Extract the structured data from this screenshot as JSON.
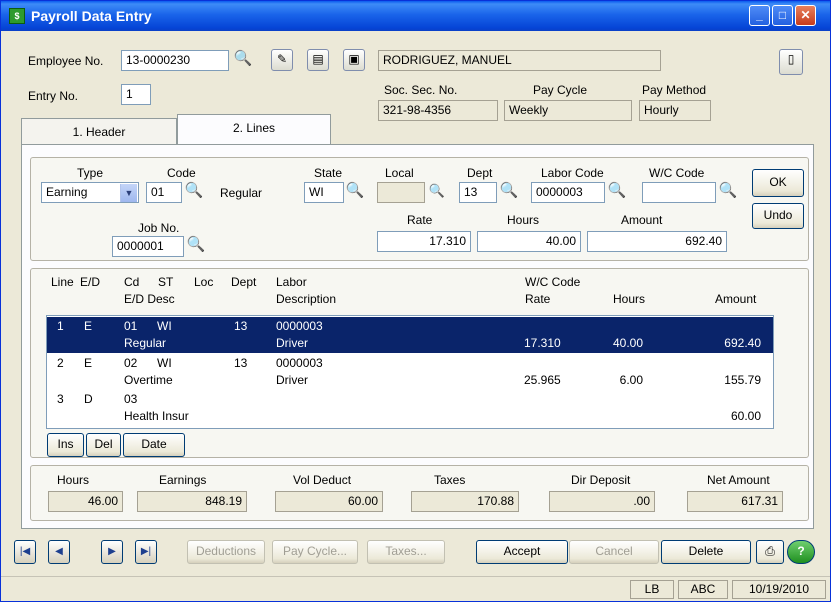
{
  "window": {
    "title": "Payroll Data Entry"
  },
  "header": {
    "employee_no_label": "Employee No.",
    "employee_no": "13-0000230",
    "employee_name": "RODRIGUEZ, MANUEL",
    "entry_no_label": "Entry No.",
    "entry_no": "1",
    "ssn_label": "Soc. Sec. No.",
    "ssn": "321-98-4356",
    "pay_cycle_label": "Pay Cycle",
    "pay_cycle": "Weekly",
    "pay_method_label": "Pay Method",
    "pay_method": "Hourly"
  },
  "tabs": [
    {
      "label": "1. Header",
      "active": false
    },
    {
      "label": "2. Lines",
      "active": true
    }
  ],
  "line_entry": {
    "type_label": "Type",
    "type_value": "Earning",
    "code_label": "Code",
    "code_value": "01",
    "code_desc": "Regular",
    "state_label": "State",
    "state_value": "WI",
    "local_label": "Local",
    "local_value": "",
    "dept_label": "Dept",
    "dept_value": "13",
    "labor_code_label": "Labor Code",
    "labor_code_value": "0000003",
    "wc_code_label": "W/C Code",
    "wc_code_value": "",
    "job_no_label": "Job No.",
    "job_no_value": "0000001",
    "rate_label": "Rate",
    "rate_value": "17.310",
    "hours_label": "Hours",
    "hours_value": "40.00",
    "amount_label": "Amount",
    "amount_value": "692.40",
    "ok_label": "OK",
    "undo_label": "Undo"
  },
  "grid": {
    "headers_row1": [
      "Line",
      "E/D",
      "Cd",
      "ST",
      "Loc",
      "Dept",
      "Labor",
      "W/C Code"
    ],
    "headers_row2": [
      "E/D Desc",
      "Description",
      "Rate",
      "Hours",
      "Amount"
    ],
    "rows": [
      {
        "line": "1",
        "ed": "E",
        "cd": "01",
        "st": "WI",
        "dept": "13",
        "labor": "0000003",
        "desc": "Regular",
        "labor_desc": "Driver",
        "rate": "17.310",
        "hours": "40.00",
        "amount": "692.40",
        "selected": true
      },
      {
        "line": "2",
        "ed": "E",
        "cd": "02",
        "st": "WI",
        "dept": "13",
        "labor": "0000003",
        "desc": "Overtime",
        "labor_desc": "Driver",
        "rate": "25.965",
        "hours": "6.00",
        "amount": "155.79",
        "selected": false
      },
      {
        "line": "3",
        "ed": "D",
        "cd": "03",
        "st": "",
        "dept": "",
        "labor": "",
        "desc": "Health Insur",
        "labor_desc": "",
        "rate": "",
        "hours": "",
        "amount": "60.00",
        "selected": false
      }
    ],
    "ins_label": "Ins",
    "del_label": "Del",
    "date_label": "Date"
  },
  "totals": {
    "hours_label": "Hours",
    "hours": "46.00",
    "earnings_label": "Earnings",
    "earnings": "848.19",
    "vol_deduct_label": "Vol Deduct",
    "vol_deduct": "60.00",
    "taxes_label": "Taxes",
    "taxes": "170.88",
    "dir_deposit_label": "Dir Deposit",
    "dir_deposit": ".00",
    "net_amount_label": "Net Amount",
    "net_amount": "617.31"
  },
  "footer": {
    "deductions_label": "Deductions",
    "pay_cycle_label": "Pay Cycle...",
    "taxes_label": "Taxes...",
    "accept_label": "Accept",
    "cancel_label": "Cancel",
    "delete_label": "Delete"
  },
  "status": {
    "user": "LB",
    "company": "ABC",
    "date": "10/19/2010"
  }
}
